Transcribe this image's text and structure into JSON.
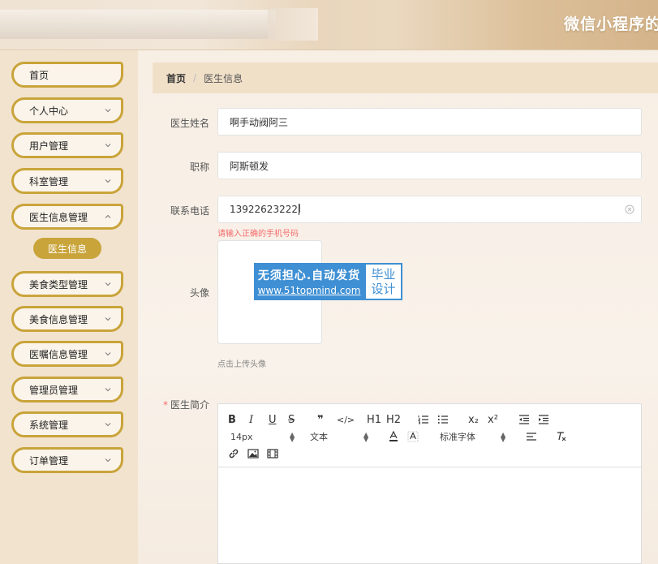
{
  "header": {
    "title": "微信小程序的"
  },
  "sidebar": {
    "items": [
      {
        "label": "首页",
        "has_chevron": false
      },
      {
        "label": "个人中心",
        "has_chevron": true
      },
      {
        "label": "用户管理",
        "has_chevron": true
      },
      {
        "label": "科室管理",
        "has_chevron": true
      },
      {
        "label": "医生信息管理",
        "has_chevron": true
      },
      {
        "label": "美食类型管理",
        "has_chevron": true
      },
      {
        "label": "美食信息管理",
        "has_chevron": true
      },
      {
        "label": "医嘱信息管理",
        "has_chevron": true
      },
      {
        "label": "管理员管理",
        "has_chevron": true
      },
      {
        "label": "系统管理",
        "has_chevron": true
      },
      {
        "label": "订单管理",
        "has_chevron": true
      }
    ],
    "sub_item": {
      "label": "医生信息"
    }
  },
  "breadcrumb": {
    "home": "首页",
    "separator": "/",
    "current": "医生信息"
  },
  "form": {
    "name_label": "医生姓名",
    "name_value": "啊手动阀阿三",
    "title_label": "职称",
    "title_value": "阿斯顿发",
    "phone_label": "联系电话",
    "phone_value": "13922623222",
    "phone_error": "请输入正确的手机号码",
    "avatar_label": "头像",
    "avatar_hint": "点击上传头像",
    "intro_label": "医生简介",
    "intro_required": "*"
  },
  "watermark": {
    "line1": "无须担心.自动发货",
    "line2": "www.51topmind.com",
    "right1": "毕业",
    "right2": "设计"
  },
  "editor": {
    "bold": "B",
    "italic": "I",
    "underline": "U",
    "strike": "S",
    "quote": "❞",
    "code": "</>",
    "h1": "H1",
    "h2": "H2",
    "subscript": "x₂",
    "superscript": "x²",
    "font_size": "14px",
    "font_type": "文本",
    "font_family": "标准字体"
  },
  "colors": {
    "accent": "#c9a43a",
    "error": "#f56c6c",
    "watermark_blue": "#3e8fd3"
  }
}
